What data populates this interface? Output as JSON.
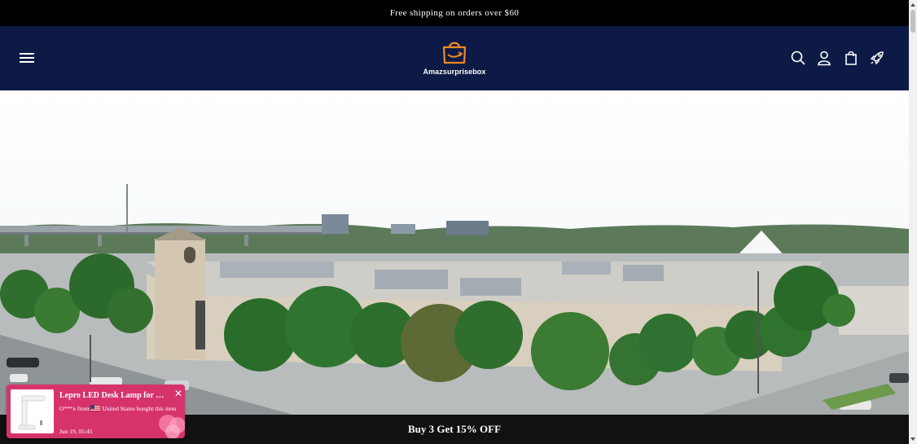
{
  "announcement": {
    "text": "Free shipping on orders over $60"
  },
  "header": {
    "brand": "Amazsurprisebox",
    "icons": [
      "menu-icon",
      "search-icon",
      "account-icon",
      "cart-icon",
      "rocket-icon"
    ],
    "colors": {
      "background": "#0c1a45",
      "logo_accent": "#f08a24"
    }
  },
  "hero": {
    "image": "aerial view of a large mall building with trees and a crowd queued outside"
  },
  "promo": {
    "text": "Buy 3 Get 15% OFF"
  },
  "popup": {
    "title": "Lepro LED Desk Lamp for Ho...",
    "close": "✕",
    "buyer": "O***e from",
    "location_text": "United States bought this item",
    "time": "Jun 19, 05:45",
    "color": "#d6336c"
  }
}
